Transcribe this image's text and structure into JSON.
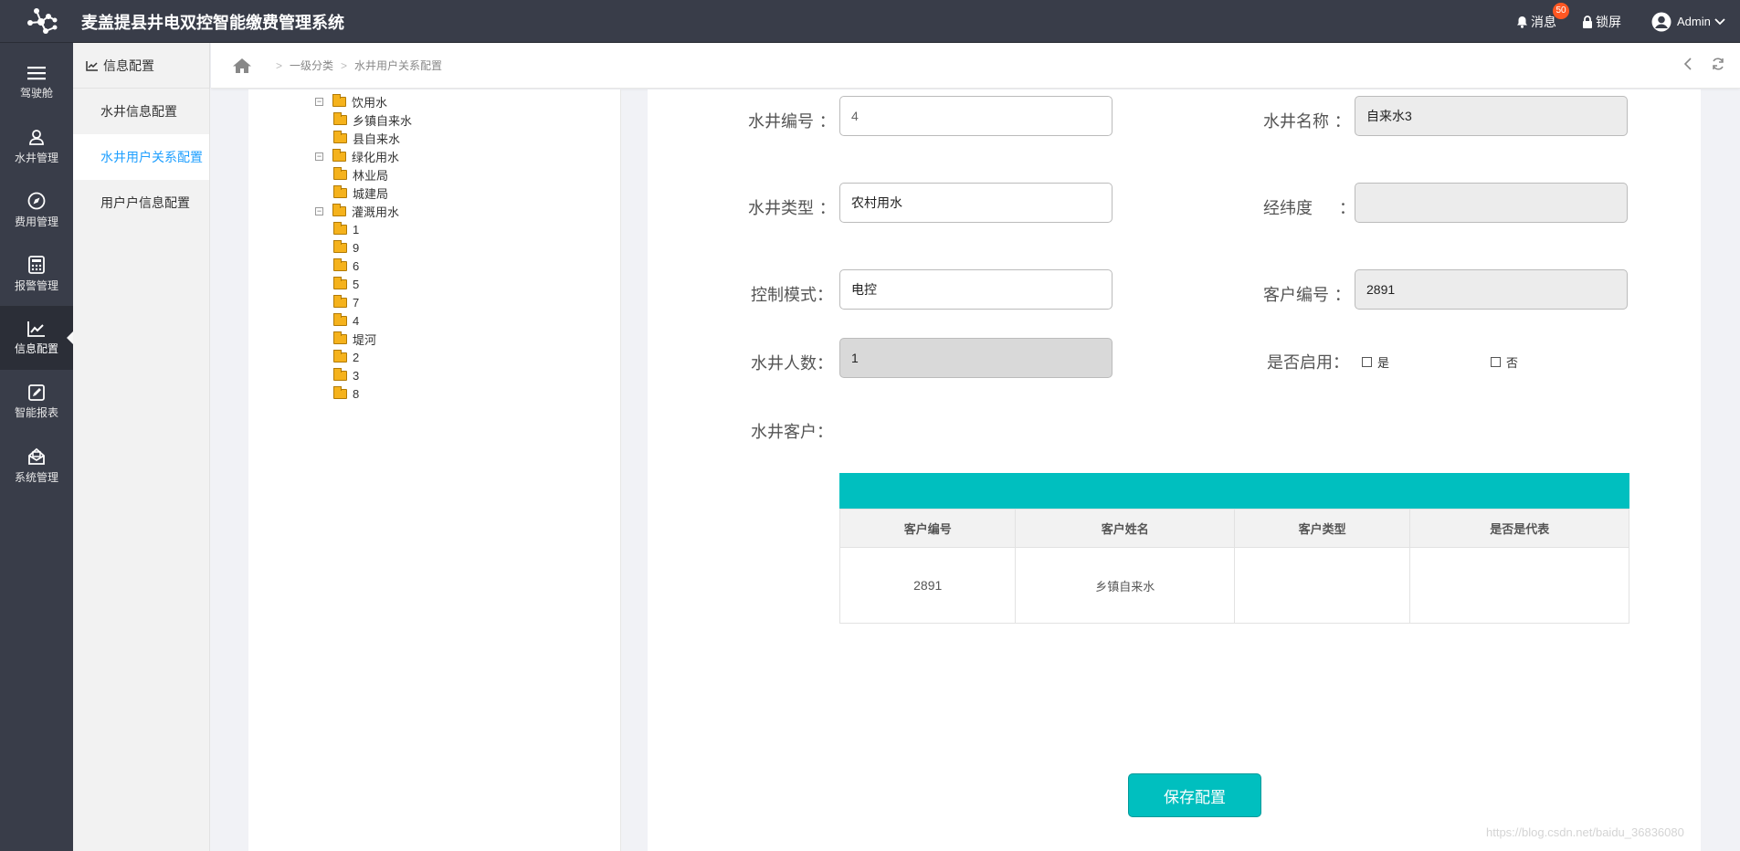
{
  "header": {
    "title": "麦盖提县井电双控智能缴费管理系统",
    "messages_label": "消息",
    "messages_count": "50",
    "lock_label": "锁屏",
    "user_label": "Admin"
  },
  "sidebar": {
    "items": [
      {
        "label": "驾驶舱",
        "icon": "menu-icon"
      },
      {
        "label": "水井管理",
        "icon": "user-icon"
      },
      {
        "label": "费用管理",
        "icon": "compass-icon"
      },
      {
        "label": "报警管理",
        "icon": "calculator-icon"
      },
      {
        "label": "信息配置",
        "icon": "chart-icon",
        "active": true
      },
      {
        "label": "智能报表",
        "icon": "edit-icon"
      },
      {
        "label": "系统管理",
        "icon": "inbox-icon"
      }
    ]
  },
  "submenu": {
    "title": "信息配置",
    "items": [
      {
        "label": "水井信息配置"
      },
      {
        "label": "水井用户关系配置",
        "active": true
      },
      {
        "label": "用户户信息配置"
      }
    ]
  },
  "breadcrumb": {
    "level1": "一级分类",
    "level2": "水井用户关系配置"
  },
  "tree": {
    "groups": [
      {
        "label": "饮用水",
        "children": [
          "乡镇自来水",
          "县自来水"
        ]
      },
      {
        "label": "绿化用水",
        "children": [
          "林业局",
          "城建局"
        ]
      },
      {
        "label": "灌溉用水",
        "children": [
          "1",
          "9",
          "6",
          "5",
          "7",
          "4",
          "堤河",
          "2",
          "3",
          "8"
        ]
      }
    ]
  },
  "form": {
    "well_no_label": "水井编号 ：",
    "well_no_value": "4",
    "well_name_label": "水井名称 ：",
    "well_name_value": "自来水3",
    "well_type_label": "水井类型 ：",
    "well_type_value": "农村用水",
    "latlng_label": "经纬度",
    "latlng_colon": "：",
    "latlng_value": "",
    "control_label": "控制模式：",
    "control_value": "电控",
    "customer_no_label": "客户编号 ：",
    "customer_no_value": "2891",
    "people_label": "水井人数：",
    "people_value": "1",
    "enabled_label": "是否启用：",
    "enabled_yes": "是",
    "enabled_no": "否",
    "customers_label": "水井客户："
  },
  "table": {
    "headers": [
      "客户编号",
      "客户姓名",
      "客户类型",
      "是否是代表"
    ],
    "rows": [
      [
        "2891",
        "乡镇自来水",
        "",
        ""
      ]
    ]
  },
  "actions": {
    "save_label": "保存配置"
  },
  "watermark": "https://blog.csdn.net/baidu_36836080",
  "colors": {
    "header_bg": "#393d49",
    "accent_teal": "#00bfbf",
    "active_link": "#1e9fff",
    "badge": "#ff5722"
  }
}
